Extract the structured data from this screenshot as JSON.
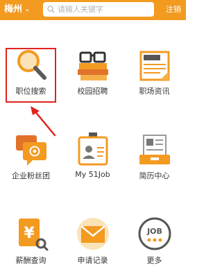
{
  "header": {
    "city": "梅州",
    "search_placeholder": "请输人关键字",
    "logout_label": "注销"
  },
  "grid": {
    "items": [
      {
        "label": "职位搜索",
        "icon": "magnifier-icon"
      },
      {
        "label": "校园招聘",
        "icon": "books-glasses-icon"
      },
      {
        "label": "职场资讯",
        "icon": "newspaper-icon"
      },
      {
        "label": "企业粉丝团",
        "icon": "chat-bubbles-icon"
      },
      {
        "label": "My 51Job",
        "icon": "badge-icon"
      },
      {
        "label": "简历中心",
        "icon": "resume-icon"
      },
      {
        "label": "薪酬查询",
        "icon": "salary-icon"
      },
      {
        "label": "申请记录",
        "icon": "envelope-icon"
      },
      {
        "label": "更多",
        "icon": "job-more-icon"
      }
    ]
  },
  "annotation": {
    "highlight_color": "#e0231e"
  },
  "colors": {
    "brand": "#f39a21"
  }
}
